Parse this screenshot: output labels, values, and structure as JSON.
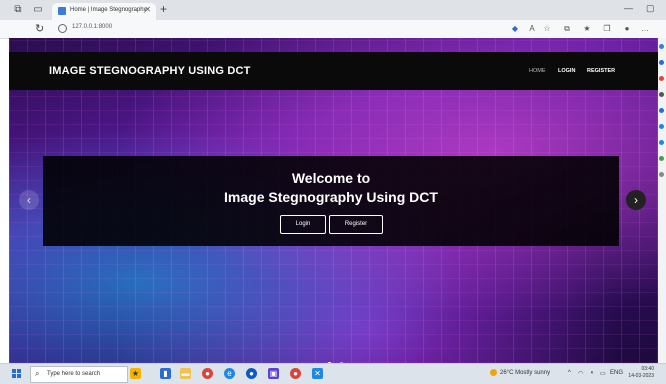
{
  "browser": {
    "tab_title": "Home | Image Stegnography",
    "url": "127.0.0.1:8000"
  },
  "navbar": {
    "brand": "IMAGE STEGNOGRAPHY USING DCT",
    "links": [
      "HOME",
      "LOGIN",
      "REGISTER"
    ]
  },
  "hero": {
    "welcome": "Welcome to",
    "title": "Image Stegnography Using DCT",
    "login_label": "Login",
    "register_label": "Register"
  },
  "taskbar": {
    "search_placeholder": "Type here to search",
    "weather": "26°C  Mostly sunny",
    "language": "ENG",
    "time": "03:40",
    "date": "14-03-2023"
  },
  "colors": {
    "navbar_bg": "#0a0a0a",
    "panel_bg": "rgba(0,0,0,0.88)",
    "accent_purple": "#5b1aa0"
  }
}
